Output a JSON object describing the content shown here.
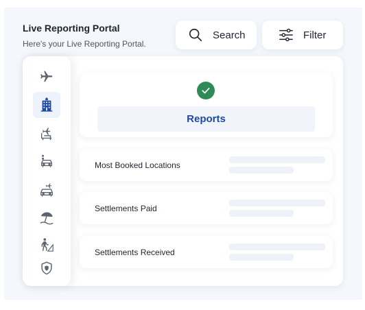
{
  "header": {
    "title": "Live Reporting Portal",
    "subtitle": "Here's your Live Reporting Portal."
  },
  "toolbar": {
    "search_label": "Search",
    "filter_label": "Filter"
  },
  "sidebar": {
    "items": [
      {
        "icon": "airplane-icon",
        "active": false
      },
      {
        "icon": "hotel-icon",
        "active": true
      },
      {
        "icon": "flight-seat-icon",
        "active": false
      },
      {
        "icon": "car-transfer-icon",
        "active": false
      },
      {
        "icon": "flight-car-icon",
        "active": false
      },
      {
        "icon": "beach-umbrella-icon",
        "active": false
      },
      {
        "icon": "hiking-icon",
        "active": false
      },
      {
        "icon": "shield-icon",
        "active": false
      }
    ]
  },
  "reports": {
    "title": "Reports",
    "status_icon": "check-circle-icon"
  },
  "rows": [
    {
      "label": "Most Booked Locations"
    },
    {
      "label": "Settlements Paid"
    },
    {
      "label": "Settlements Received"
    }
  ],
  "colors": {
    "accent": "#1c4aa3",
    "success": "#2e8b57",
    "icon": "#5d6470",
    "background": "#f4f7fb"
  }
}
